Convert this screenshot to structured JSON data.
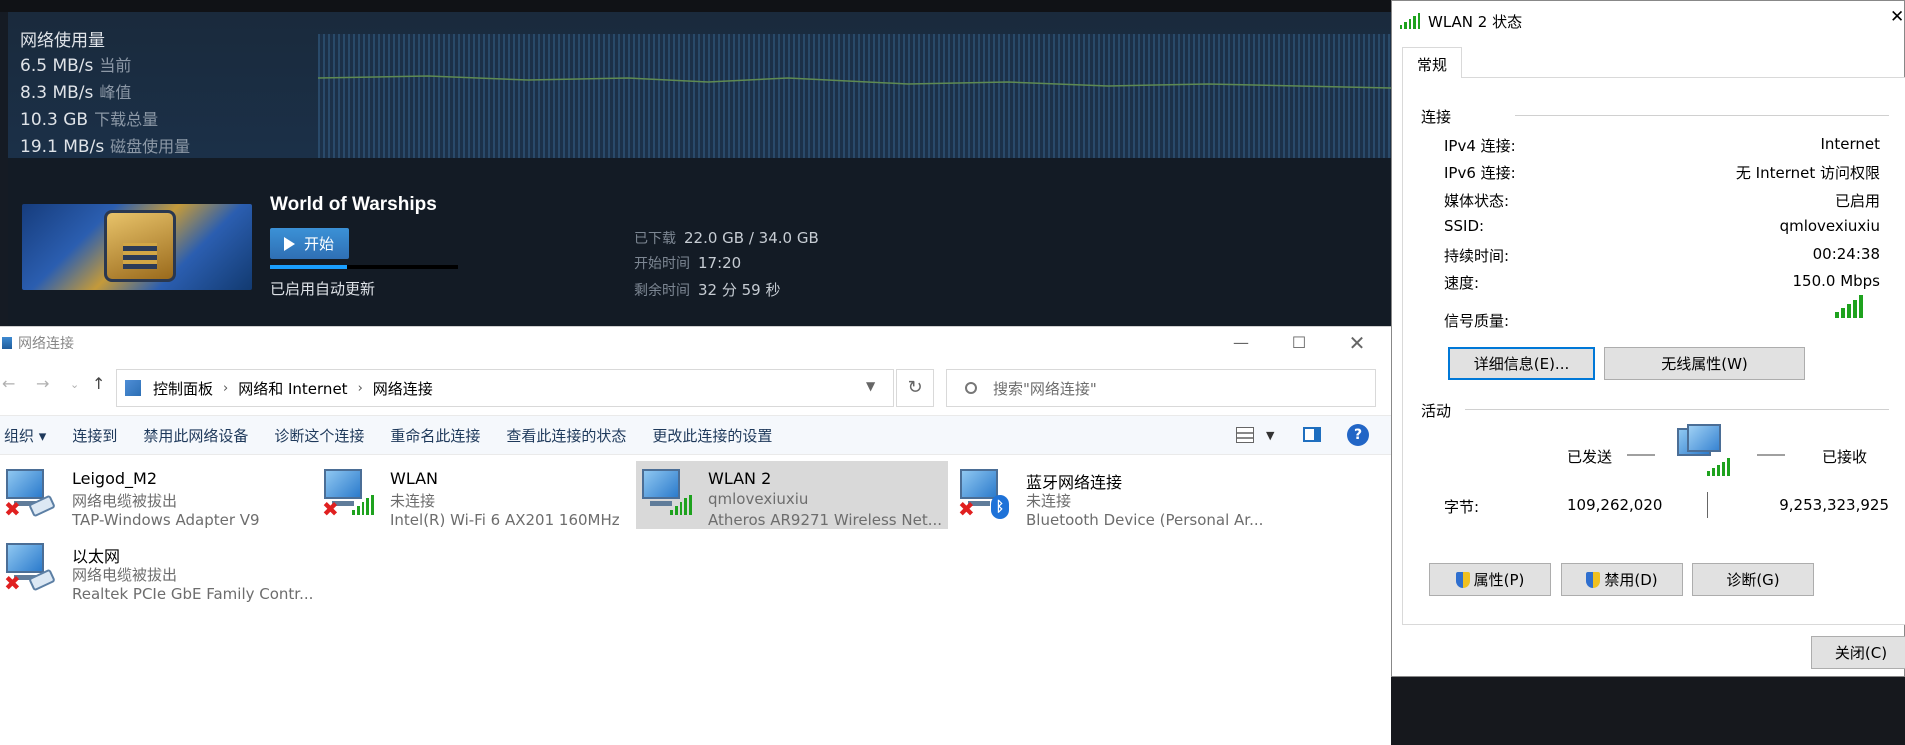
{
  "steam": {
    "network_title": "网络使用量",
    "stats": [
      {
        "value": "6.5 MB/s",
        "label": "当前"
      },
      {
        "value": "8.3 MB/s",
        "label": "峰值"
      },
      {
        "value": "10.3 GB",
        "label": "下载总量"
      },
      {
        "value": "19.1 MB/s",
        "label": "磁盘使用量"
      }
    ],
    "game_title": "World of Warships",
    "start_label": "开始",
    "auto_update": "已启用自动更新",
    "progress": 0.41,
    "download": [
      {
        "label": "已下载",
        "value": "22.0 GB / 34.0 GB"
      },
      {
        "label": "开始时间",
        "value": "17:20"
      },
      {
        "label": "剩余时间",
        "value": "32 分 59 秒"
      }
    ]
  },
  "explorer": {
    "title": "网络连接",
    "breadcrumb": [
      "控制面板",
      "网络和 Internet",
      "网络连接"
    ],
    "search_placeholder": "搜索\"网络连接\"",
    "commands": [
      "组织 ▾",
      "连接到",
      "禁用此网络设备",
      "诊断这个连接",
      "重命名此连接",
      "查看此连接的状态",
      "更改此连接的设置"
    ],
    "items": [
      {
        "name": "Leigod_M2",
        "status": "网络电缆被拔出",
        "device": "TAP-Windows Adapter V9",
        "icon": "ethernet-disconnected-icon"
      },
      {
        "name": "WLAN",
        "status": "未连接",
        "device": "Intel(R) Wi-Fi 6 AX201 160MHz",
        "icon": "wifi-disconnected-icon"
      },
      {
        "name": "WLAN 2",
        "status": "qmlovexiuxiu",
        "device": "Atheros AR9271 Wireless Net...",
        "icon": "wifi-connected-icon"
      },
      {
        "name": "蓝牙网络连接",
        "status": "未连接",
        "device": "Bluetooth Device (Personal Ar...",
        "icon": "bluetooth-disconnected-icon"
      },
      {
        "name": "以太网",
        "status": "网络电缆被拔出",
        "device": "Realtek PCIe GbE Family Contr...",
        "icon": "ethernet-disconnected-icon"
      }
    ]
  },
  "dialog": {
    "title": "WLAN 2 状态",
    "tab": "常规",
    "connection_section": "连接",
    "fields": [
      {
        "key": "IPv4 连接:",
        "value": "Internet"
      },
      {
        "key": "IPv6 连接:",
        "value": "无 Internet 访问权限"
      },
      {
        "key": "媒体状态:",
        "value": "已启用"
      },
      {
        "key": "SSID:",
        "value": "qmlovexiuxiu"
      },
      {
        "key": "持续时间:",
        "value": "00:24:38"
      },
      {
        "key": "速度:",
        "value": "150.0 Mbps"
      }
    ],
    "signal_label": "信号质量:",
    "details_button": "详细信息(E)...",
    "wireless_props_button": "无线属性(W)",
    "activity_section": "活动",
    "sent_label": "已发送",
    "received_label": "已接收",
    "bytes_label": "字节:",
    "bytes_sent": "109,262,020",
    "bytes_received": "9,253,323,925",
    "properties_button": "属性(P)",
    "disable_button": "禁用(D)",
    "diagnose_button": "诊断(G)",
    "close_button": "关闭(C)"
  }
}
